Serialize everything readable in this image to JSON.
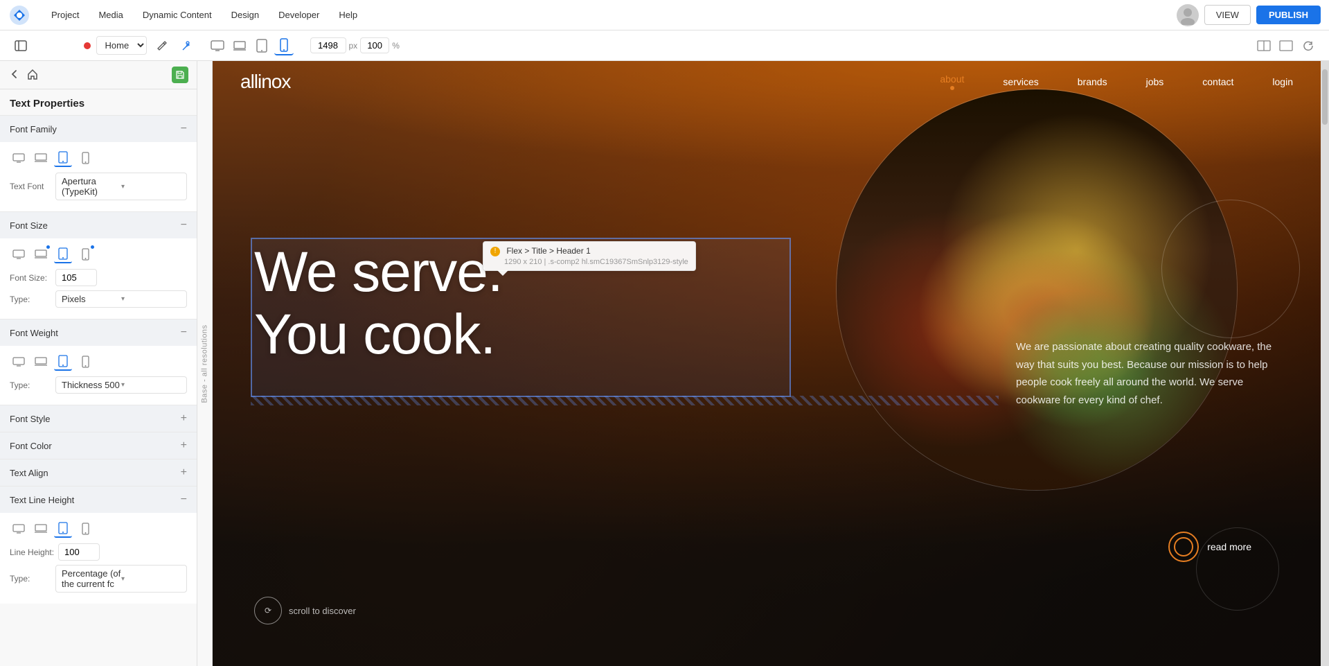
{
  "topbar": {
    "menu_items": [
      "Project",
      "Media",
      "Dynamic Content",
      "Design",
      "Developer",
      "Help"
    ],
    "view_label": "VIEW",
    "publish_label": "PUBLISH"
  },
  "secondbar": {
    "page_name": "Home",
    "width_value": "1498",
    "width_unit": "px",
    "zoom_value": "100",
    "zoom_unit": "%"
  },
  "leftpanel": {
    "title": "Text Properties",
    "back_label": "←",
    "font_family": {
      "label": "Font Family",
      "text_font_label": "Text Font",
      "font_value": "Apertura (TypeKit)"
    },
    "font_size": {
      "label": "Font Size",
      "size_label": "Font Size:",
      "size_value": "105",
      "type_label": "Type:",
      "type_value": "Pixels"
    },
    "font_weight": {
      "label": "Font Weight",
      "type_label": "Type:",
      "type_value": "Thickness 500"
    },
    "font_style": {
      "label": "Font Style"
    },
    "font_color": {
      "label": "Font Color"
    },
    "text_align": {
      "label": "Text Align"
    },
    "text_line_height": {
      "label": "Text Line Height",
      "line_height_label": "Line Height:",
      "line_height_value": "100",
      "type_label": "Type:",
      "type_value": "Percentage (of the current fc"
    }
  },
  "vertical_label": "Base - all resolutions",
  "tooltip": {
    "path": "Flex > Title > Header 1",
    "size": "1290 x 210 | .s-comp2 hl.smC19367SmSnlp3129-style"
  },
  "site": {
    "logo": "allinox",
    "nav_links": [
      "about",
      "services",
      "brands",
      "jobs",
      "contact"
    ],
    "active_nav": "about",
    "login_label": "login",
    "hero_title_1": "We serve.",
    "hero_title_2": "You cook.",
    "hero_body": "We are passionate about creating quality cookware, the way that suits you best. Because our mission is to help people cook freely all around the world. We serve cookware for every kind of chef.",
    "read_more": "read more",
    "scroll_label": "scroll to discover"
  }
}
